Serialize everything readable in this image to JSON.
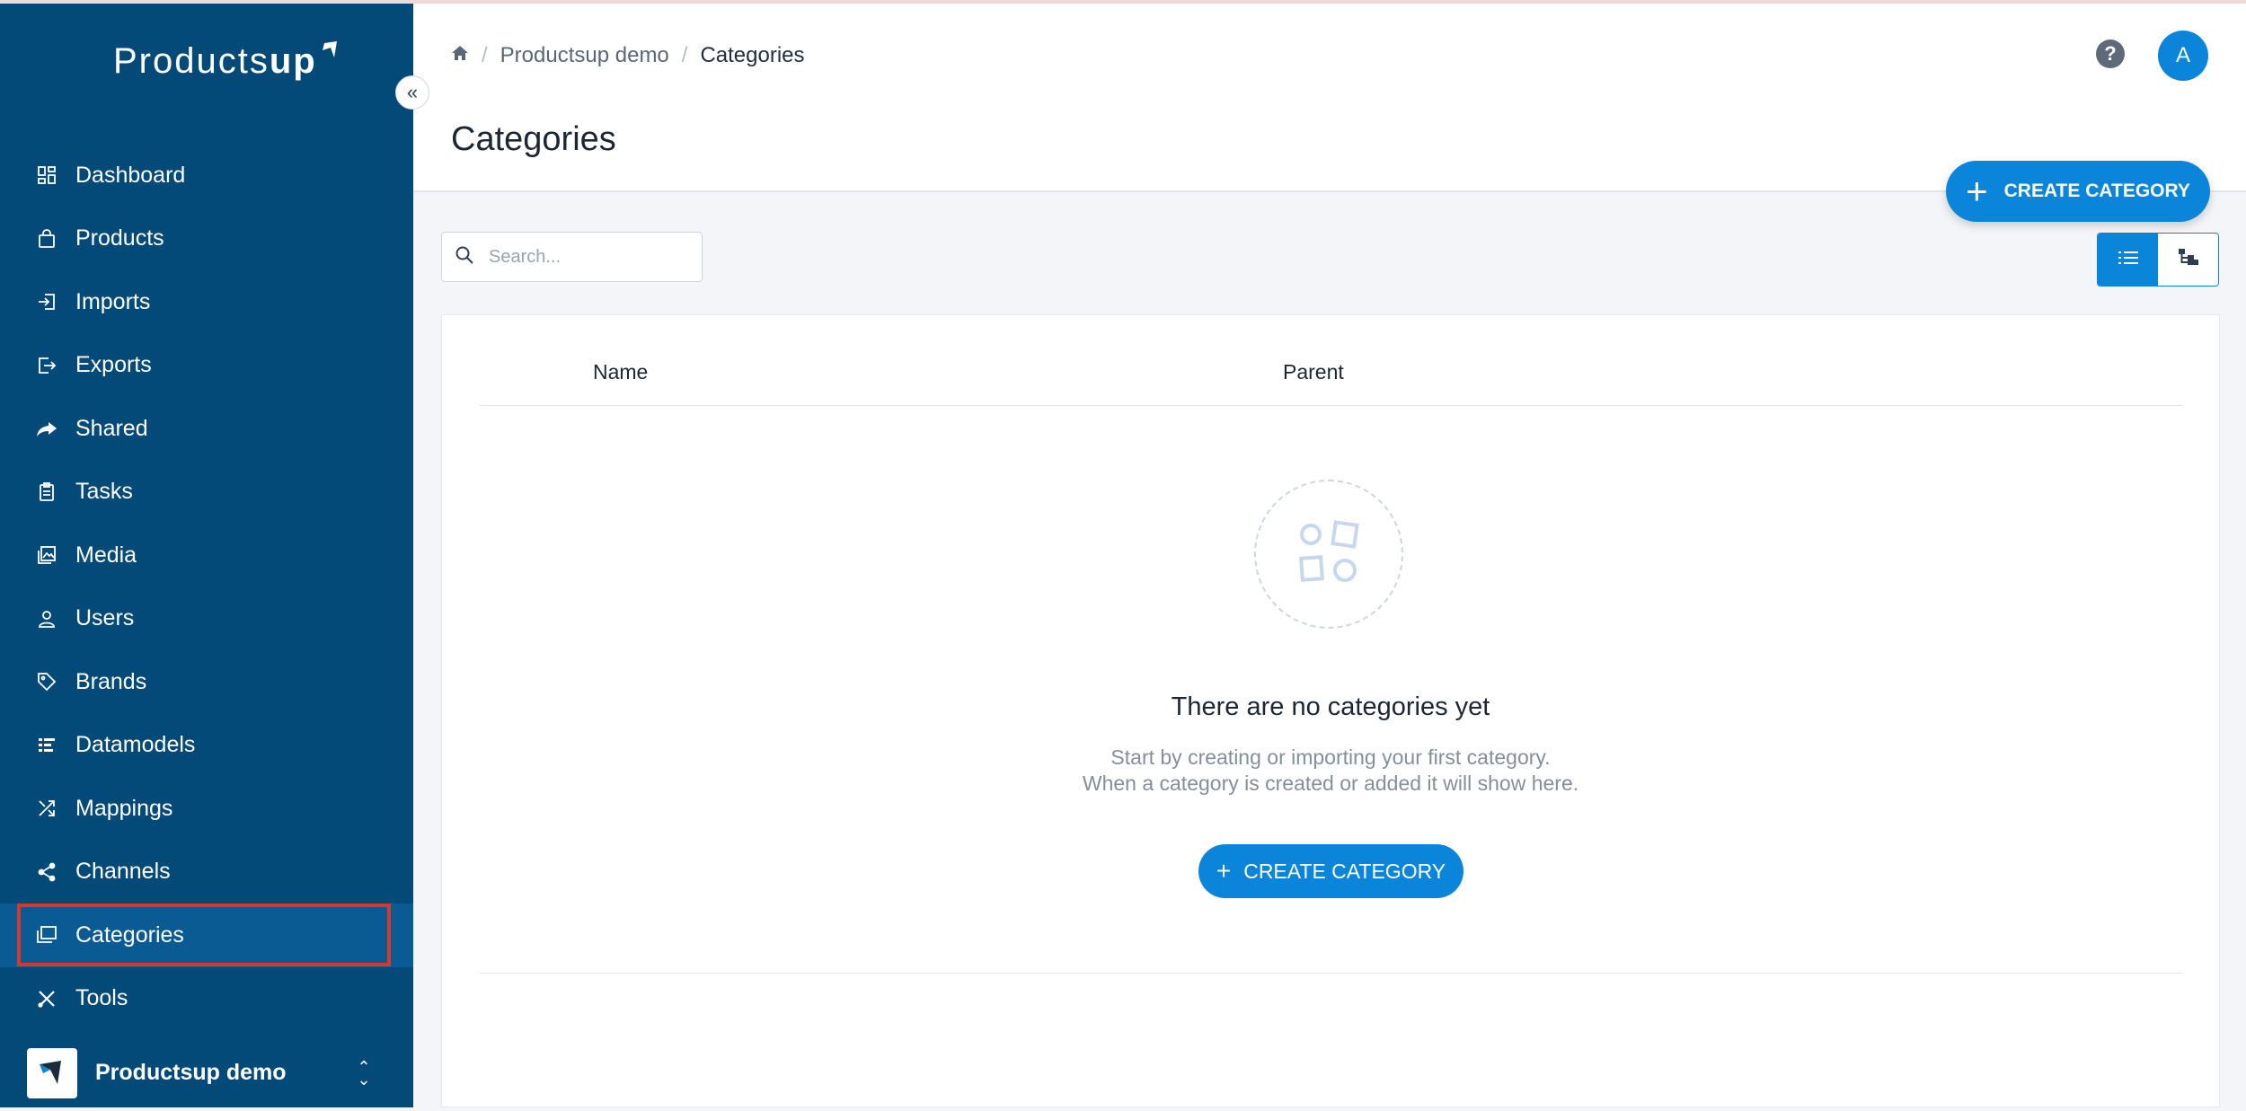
{
  "app": {
    "logo_text": "Products",
    "logo_bold": "up"
  },
  "sidebar": {
    "collapse_glyph": "«",
    "items": [
      {
        "label": "Dashboard",
        "icon": "dashboard-icon"
      },
      {
        "label": "Products",
        "icon": "bag-icon"
      },
      {
        "label": "Imports",
        "icon": "import-icon"
      },
      {
        "label": "Exports",
        "icon": "export-icon"
      },
      {
        "label": "Shared",
        "icon": "share-arrow-icon"
      },
      {
        "label": "Tasks",
        "icon": "clipboard-icon"
      },
      {
        "label": "Media",
        "icon": "image-icon"
      },
      {
        "label": "Users",
        "icon": "user-icon"
      },
      {
        "label": "Brands",
        "icon": "tag-icon"
      },
      {
        "label": "Datamodels",
        "icon": "list-icon"
      },
      {
        "label": "Mappings",
        "icon": "shuffle-icon"
      },
      {
        "label": "Channels",
        "icon": "share-nodes-icon"
      },
      {
        "label": "Categories",
        "icon": "folders-icon",
        "active": true
      },
      {
        "label": "Tools",
        "icon": "tools-icon"
      }
    ],
    "account": {
      "name": "Productsup demo"
    }
  },
  "header": {
    "breadcrumb": [
      "Productsup demo",
      "Categories"
    ],
    "title": "Categories",
    "help_glyph": "?",
    "avatar_initial": "A"
  },
  "toolbar": {
    "create_label": "CREATE CATEGORY",
    "search_placeholder": "Search..."
  },
  "table": {
    "columns": [
      "Name",
      "Parent"
    ]
  },
  "empty_state": {
    "title": "There are no categories yet",
    "line1": "Start by creating or importing your first category.",
    "line2": "When a category is created or added it will show here.",
    "button_label": "CREATE CATEGORY"
  },
  "colors": {
    "sidebar": "#034a78",
    "accent": "#0a85d9",
    "active_outline": "#d9362c"
  }
}
